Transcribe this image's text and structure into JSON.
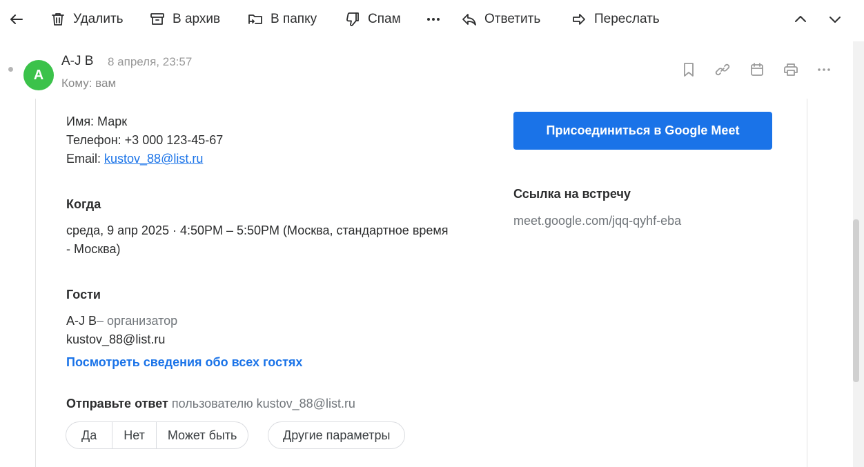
{
  "toolbar": {
    "back_icon": "arrow-left-icon",
    "delete_label": "Удалить",
    "archive_label": "В архив",
    "folder_label": "В папку",
    "spam_label": "Спам",
    "more_label": "···",
    "reply_label": "Ответить",
    "forward_label": "Переслать"
  },
  "header": {
    "avatar_letter": "A",
    "avatar_color": "#3bc24a",
    "sender": "A-J B",
    "date": "8 апреля, 23:57",
    "recipient": "Кому: вам",
    "icons": [
      "bookmark-icon",
      "link-icon",
      "calendar-icon",
      "print-icon",
      "more-icon"
    ]
  },
  "message": {
    "name_line": "Имя: Марк",
    "phone_line": "Телефон: +3 000 123-45-67",
    "email_label": "Email: ",
    "email_link": "kustov_88@list.ru",
    "when_heading": "Когда",
    "when_line1": "среда, 9 апр 2025 · 4:50PM – 5:50PM (Москва, стандартное время",
    "when_line2": "- Москва)",
    "guests_heading": "Гости",
    "guest1_name": "A-J B",
    "guest1_role": "– организатор",
    "guest2": "kustov_88@list.ru",
    "view_guests_link": "Посмотреть сведения обо всех гостях",
    "reply_heading": "Отправьте ответ",
    "reply_to": "пользователю kustov_88@list.ru",
    "rsvp": {
      "yes": "Да",
      "no": "Нет",
      "maybe": "Может быть",
      "other": "Другие параметры"
    }
  },
  "meet": {
    "join_button": "Присоединиться в Google Meet",
    "link_heading": "Ссылка на встречу",
    "link_url": "meet.google.com/jqq-qyhf-eba",
    "accent": "#1a73e8"
  }
}
